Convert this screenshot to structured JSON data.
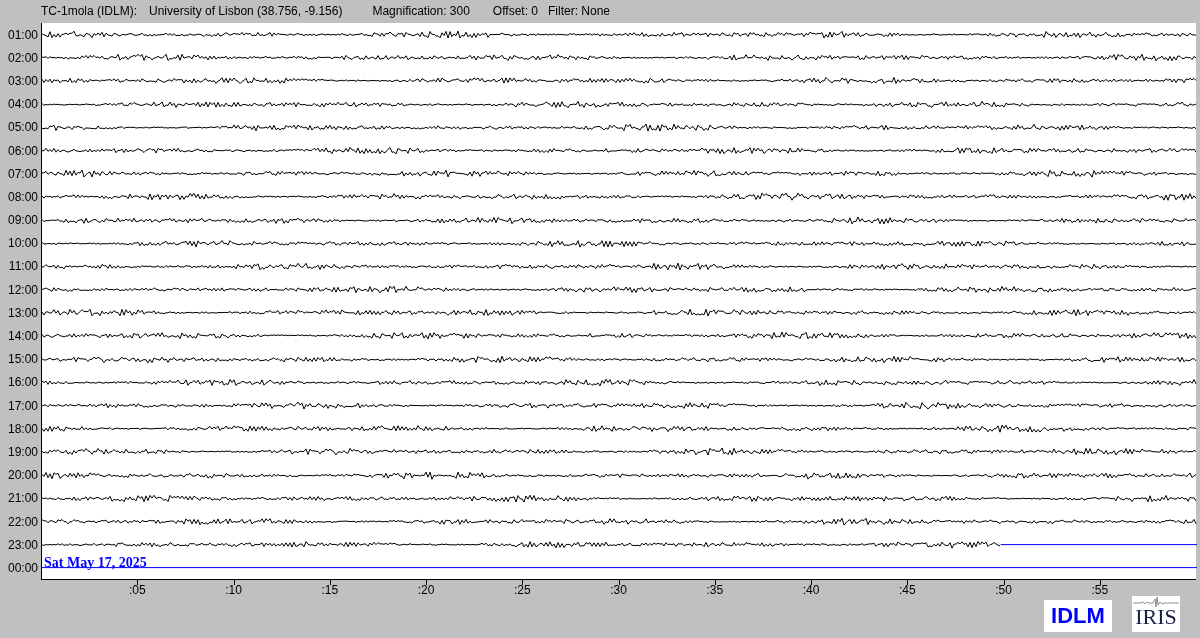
{
  "header": {
    "station": "TC-1mola (IDLM):",
    "location": "University of Lisbon (38.756, -9.156)",
    "magnification": "Magnification: 300",
    "offset": "Offset: 0",
    "filter": "Filter: None"
  },
  "rows": [
    {
      "label": "01:00",
      "kind": "full"
    },
    {
      "label": "02:00",
      "kind": "full"
    },
    {
      "label": "03:00",
      "kind": "full"
    },
    {
      "label": "04:00",
      "kind": "full"
    },
    {
      "label": "05:00",
      "kind": "full"
    },
    {
      "label": "06:00",
      "kind": "full"
    },
    {
      "label": "07:00",
      "kind": "full"
    },
    {
      "label": "08:00",
      "kind": "full"
    },
    {
      "label": "09:00",
      "kind": "full"
    },
    {
      "label": "10:00",
      "kind": "full"
    },
    {
      "label": "11:00",
      "kind": "full"
    },
    {
      "label": "12:00",
      "kind": "full"
    },
    {
      "label": "13:00",
      "kind": "full"
    },
    {
      "label": "14:00",
      "kind": "full"
    },
    {
      "label": "15:00",
      "kind": "full"
    },
    {
      "label": "16:00",
      "kind": "full"
    },
    {
      "label": "17:00",
      "kind": "full"
    },
    {
      "label": "18:00",
      "kind": "full"
    },
    {
      "label": "19:00",
      "kind": "full"
    },
    {
      "label": "20:00",
      "kind": "full"
    },
    {
      "label": "21:00",
      "kind": "full"
    },
    {
      "label": "22:00",
      "kind": "full"
    },
    {
      "label": "23:00",
      "kind": "partial"
    },
    {
      "label": "00:00",
      "kind": "pending"
    }
  ],
  "date": "Sat May 17, 2025",
  "x_ticks": [
    ":05",
    ":10",
    ":15",
    ":20",
    ":25",
    ":30",
    ":35",
    ":40",
    ":45",
    ":50",
    ":55"
  ],
  "logos": {
    "station": "IDLM",
    "network": "IRIS"
  }
}
